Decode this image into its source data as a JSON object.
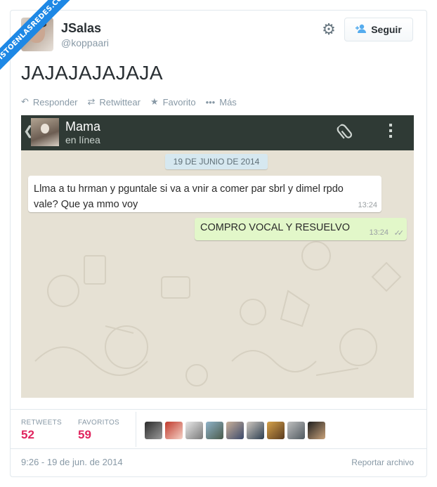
{
  "watermark": "VISTOENLASREDES.COM",
  "author": {
    "name": "JSalas",
    "handle": "@koppaari"
  },
  "header": {
    "follow_label": "Seguir",
    "gear_icon": "gear-icon",
    "follow_icon": "person-plus-icon"
  },
  "tweet": {
    "text": "JAJAJAJAJAJA"
  },
  "actions": [
    {
      "label": "Responder",
      "icon": "reply-icon"
    },
    {
      "label": "Retwittear",
      "icon": "retweet-icon"
    },
    {
      "label": "Favorito",
      "icon": "star-icon"
    },
    {
      "label": "Más",
      "icon": "more-icon"
    }
  ],
  "whatsapp": {
    "contact_name": "Mama",
    "contact_status": "en línea",
    "date_chip": "19 DE JUNIO DE 2014",
    "messages": [
      {
        "direction": "incoming",
        "text": "Llma a tu hrman y pguntale si va a vnir a comer par sbrl y dimel rpdo vale? Que ya mmo voy",
        "time": "13:24"
      },
      {
        "direction": "outgoing",
        "text": "COMPRO VOCAL Y RESUELVO",
        "time": "13:24",
        "status_icon": "double-check-icon"
      }
    ],
    "colors": {
      "header": "#2f3a35",
      "incoming": "#ffffff",
      "outgoing": "#e2f7c9",
      "wallpaper": "#e6e1d4"
    }
  },
  "stats": {
    "retweets_label": "RETWEETS",
    "retweets_value": "52",
    "favorites_label": "FAVORITOS",
    "favorites_value": "59",
    "favoriters_count": 9
  },
  "footer": {
    "timestamp": "9:26 - 19 de jun. de 2014",
    "report_label": "Reportar archivo"
  },
  "colors": {
    "accent": "#55acee",
    "stat_value": "#e0245e",
    "muted": "#8899a6"
  }
}
